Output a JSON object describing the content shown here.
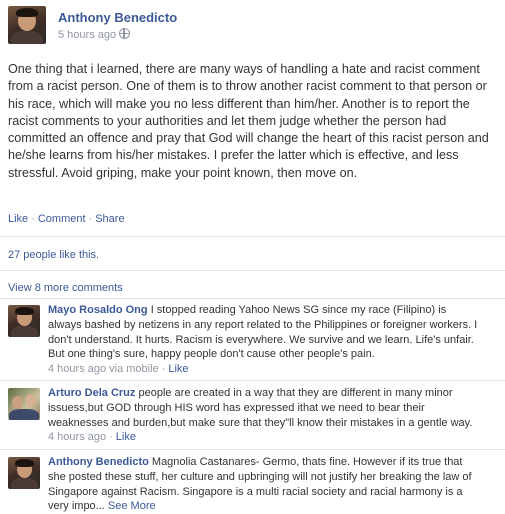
{
  "post": {
    "author": "Anthony Benedicto",
    "time": "5 hours ago",
    "body": "One thing that i learned, there are many ways of handling a hate and racist comment from a racist person. One of them is to throw another racist comment to that person or his race, which will make you no less different than him/her. Another is to report the racist comments to your authorities and let them judge whether the person had committed an offence and pray that God will change the heart of this racist person and he/she learns from his/her mistakes. I prefer the latter which is effective, and less stressful. Avoid griping, make your point known, then move on."
  },
  "actions": {
    "like": "Like",
    "comment": "Comment",
    "share": "Share",
    "separator": "·"
  },
  "likes": "27 people like this.",
  "view_more": "View 8 more comments",
  "comments": [
    {
      "name": "Mayo Rosaldo Ong",
      "text": "I stopped reading Yahoo News SG since my race (Filipino) is always bashed by netizens in any report related to the Philippines or foreigner workers. I don't understand. It hurts. Racism is everywhere. We survive and we learn. Life's unfair. But one thing's sure, happy people don't cause other people's pain.",
      "time": "4 hours ago via mobile",
      "like": "Like"
    },
    {
      "name": "Arturo Dela Cruz",
      "text": "people are created in a way that they are different in many minor issuess,but GOD through HIS word has expressed ithat we need to bear their weaknesses and burden,but make sure that they\"ll know their mistakes in a gentle way.",
      "time": "4 hours ago",
      "like": "Like"
    },
    {
      "name": "Anthony Benedicto",
      "text": "Magnolia Castanares- Germo, thats fine. However if its true that she posted these stuff, her culture and upbringing will not justify her breaking the law of Singapore against Racism. Singapore is a multi racial society and racial harmony is a very impo...",
      "see_more": "See More"
    }
  ],
  "icons": {
    "privacy": "globe-icon"
  }
}
